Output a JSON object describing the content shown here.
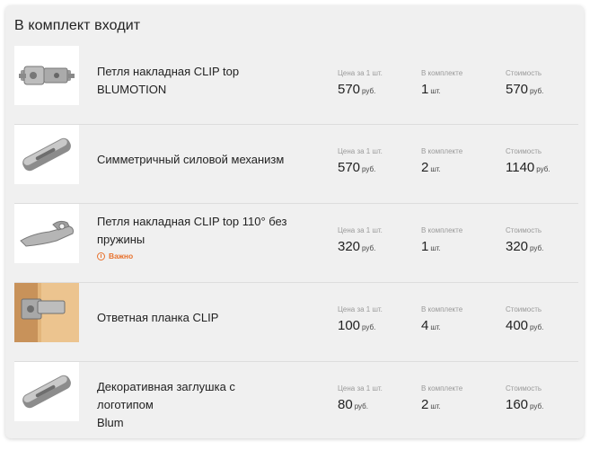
{
  "section_title": "В комплект входит",
  "labels": {
    "price": "Цена за 1 шт.",
    "qty": "В комплекте",
    "cost": "Стоимость"
  },
  "units": {
    "currency": "руб.",
    "pieces": "шт."
  },
  "colors": {
    "card_bg": "#f0f0f0",
    "warning": "#e8722e",
    "muted_label": "#9a9a9a"
  },
  "items": [
    {
      "name_line1": "Петля накладная CLIP top",
      "name_line2": "BLUMOTION",
      "warning": "",
      "price": "570",
      "qty": "1",
      "cost": "570",
      "image": "hinge-photo"
    },
    {
      "name_line1": "Симметричный силовой механизм",
      "name_line2": "",
      "warning": "",
      "price": "570",
      "qty": "2",
      "cost": "1140",
      "image": "cover-cap-photo"
    },
    {
      "name_line1": "Петля накладная CLIP top 110° без",
      "name_line2": "пружины",
      "warning": "Важно",
      "price": "320",
      "qty": "1",
      "cost": "320",
      "image": "hinge-arm-photo"
    },
    {
      "name_line1": "Ответная планка CLIP",
      "name_line2": "",
      "warning": "",
      "price": "100",
      "qty": "4",
      "cost": "400",
      "image": "mounting-plate-photo"
    },
    {
      "name_line1": "Декоративная заглушка с логотипом",
      "name_line2": "Blum",
      "warning": "",
      "price": "80",
      "qty": "2",
      "cost": "160",
      "image": "decorative-cap-photo"
    }
  ]
}
